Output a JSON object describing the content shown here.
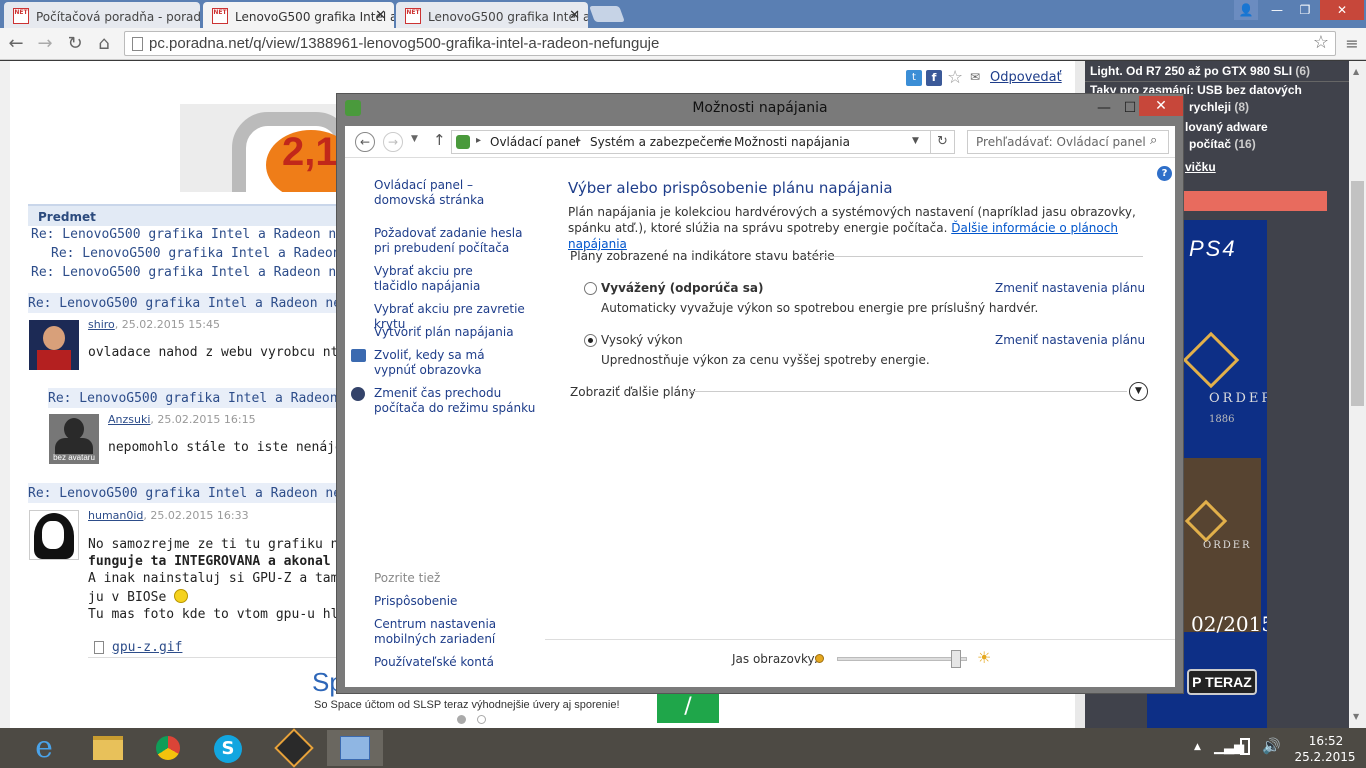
{
  "browser": {
    "tabs": [
      {
        "title": "Počítačová poradňa - porad"
      },
      {
        "title": "LenovoG500 grafika Intel a"
      },
      {
        "title": "LenovoG500 grafika Intel a"
      }
    ],
    "address": "pc.poradna.net/q/view/1388961-lenovog500-grafika-intel-a-radeon-nefunguje"
  },
  "page": {
    "reply_link": "Odpovedať",
    "ad_text": "2,1",
    "table_header": "Predmet",
    "thread_links": [
      "Re: LenovoG500 grafika Intel a Radeon nefun",
      "Re: LenovoG500 grafika Intel a Radeon ne",
      "Re: LenovoG500 grafika Intel a Radeon nefun"
    ],
    "posts": [
      {
        "title": "Re: LenovoG500 grafika Intel a Radeon nefunguj",
        "user": "shiro",
        "date": ", 25.02.2015 15:45",
        "text": "ovladace nahod z webu vyrobcu ntb."
      },
      {
        "title": "Re: LenovoG500 grafika Intel a Radeon nefun",
        "user": "Anzsuki",
        "date": ", 25.02.2015 16:15",
        "text": "nepomohlo stále to iste nenájde ju",
        "avatar_text": "bez avataru"
      },
      {
        "title": "Re: LenovoG500 grafika Intel a Radeon nefunguj",
        "user": "human0id",
        "date": ", 25.02.2015 16:33"
      }
    ],
    "post3_lines": [
      "No samozrejme ze ti tu grafiku nenaj",
      "funguje ta INTEGROVANA a akonal",
      "A inak nainstaluj si GPU-Z a tam upl",
      "ju v BIOSe",
      "Tu mas foto kde to vtom gpu-u hlada"
    ],
    "attachment": "gpu-z.gif",
    "sp_text": "Sp",
    "slsp_text": "So Space účtom od SLSP teraz výhodnejšie úvery aj sporenie!",
    "right": {
      "line1": "Light. Od R7 250 až po GTX 980 SLI",
      "line1_count": "(6)",
      "line2": "Taky pro zasmání: USB bez datových",
      "line3": "rychleji",
      "line3_count": "(8)",
      "line4": "lovaný adware",
      "line5": "počítač",
      "line5_count": "(16)",
      "line6": "vičku",
      "ps4": "PS4",
      "order": "ORDER",
      "year": "1886",
      "promo_year": "02/2015",
      "promo_btn": "P TERAZ"
    }
  },
  "dialog": {
    "title": "Možnosti napájania",
    "breadcrumb": [
      "Ovládací panel",
      "Systém a zabezpečenie",
      "Možnosti napájania"
    ],
    "search_placeholder": "Prehľadávať: Ovládací panel",
    "left_links": [
      "Ovládací panel – domovská stránka",
      "Požadovať zadanie hesla pri prebudení počítača",
      "Vybrať akciu pre tlačidlo napájania",
      "Vybrať akciu pre zavretie krytu",
      "Vytvoriť plán napájania",
      "Zvoliť, kedy sa má vypnúť obrazovka",
      "Zmeniť čas prechodu počítača do režimu spánku"
    ],
    "see_also": "Pozrite tiež",
    "see_also_links": [
      "Prispôsobenie",
      "Centrum nastavenia mobilných zariadení",
      "Používateľské kontá"
    ],
    "heading": "Výber alebo prispôsobenie plánu napájania",
    "description": "Plán napájania je kolekciou hardvérových a systémových nastavení (napríklad jasu obrazovky, spánku atď.), ktoré slúžia na správu spotreby energie počítača.",
    "more_info_link": "Ďalšie informácie o plánoch napájania",
    "plans_label": "Plány zobrazené na indikátore stavu batérie",
    "plans": [
      {
        "name": "Vyvážený (odporúča sa)",
        "desc": "Automaticky vyvažuje výkon so spotrebou energie pre príslušný hardvér.",
        "link": "Zmeniť nastavenia plánu",
        "selected": false
      },
      {
        "name": "Vysoký výkon",
        "desc": "Uprednostňuje výkon za cenu vyššej spotreby energie.",
        "link": "Zmeniť nastavenia plánu",
        "selected": true
      }
    ],
    "more_plans": "Zobraziť ďalšie plány",
    "brightness_label": "Jas obrazovky:",
    "brightness_level": 0.95
  },
  "taskbar": {
    "time": "16:52",
    "date": "25.2.2015"
  }
}
